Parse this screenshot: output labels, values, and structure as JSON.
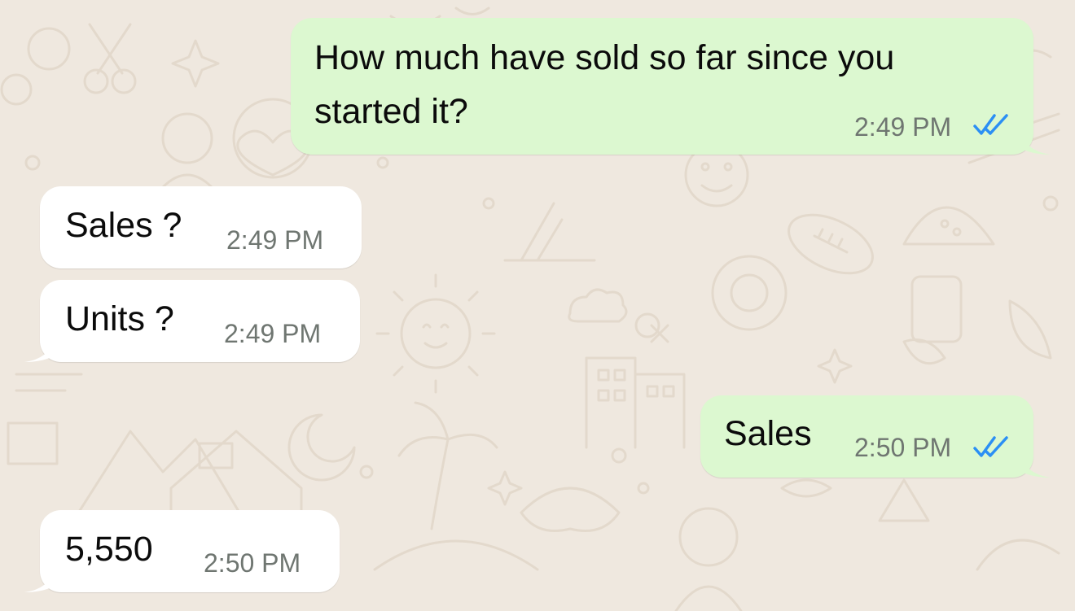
{
  "colors": {
    "background": "#efe8df",
    "outgoing_bubble": "#dcf8d0",
    "incoming_bubble": "#ffffff",
    "read_ticks": "#2b8ff4",
    "doodle_stroke": "#e2d8cc"
  },
  "messages": [
    {
      "direction": "outgoing",
      "text_line1": "How much have sold so far since you",
      "text_line2": "started it?",
      "time": "2:49 PM",
      "status_icon": "double-check-read-icon"
    },
    {
      "direction": "incoming",
      "text": "Sales ?",
      "time": "2:49 PM"
    },
    {
      "direction": "incoming",
      "text": "Units ?",
      "time": "2:49 PM"
    },
    {
      "direction": "outgoing",
      "text": "Sales",
      "time": "2:50 PM",
      "status_icon": "double-check-read-icon"
    },
    {
      "direction": "incoming",
      "text": "5,550",
      "time": "2:50 PM"
    }
  ]
}
